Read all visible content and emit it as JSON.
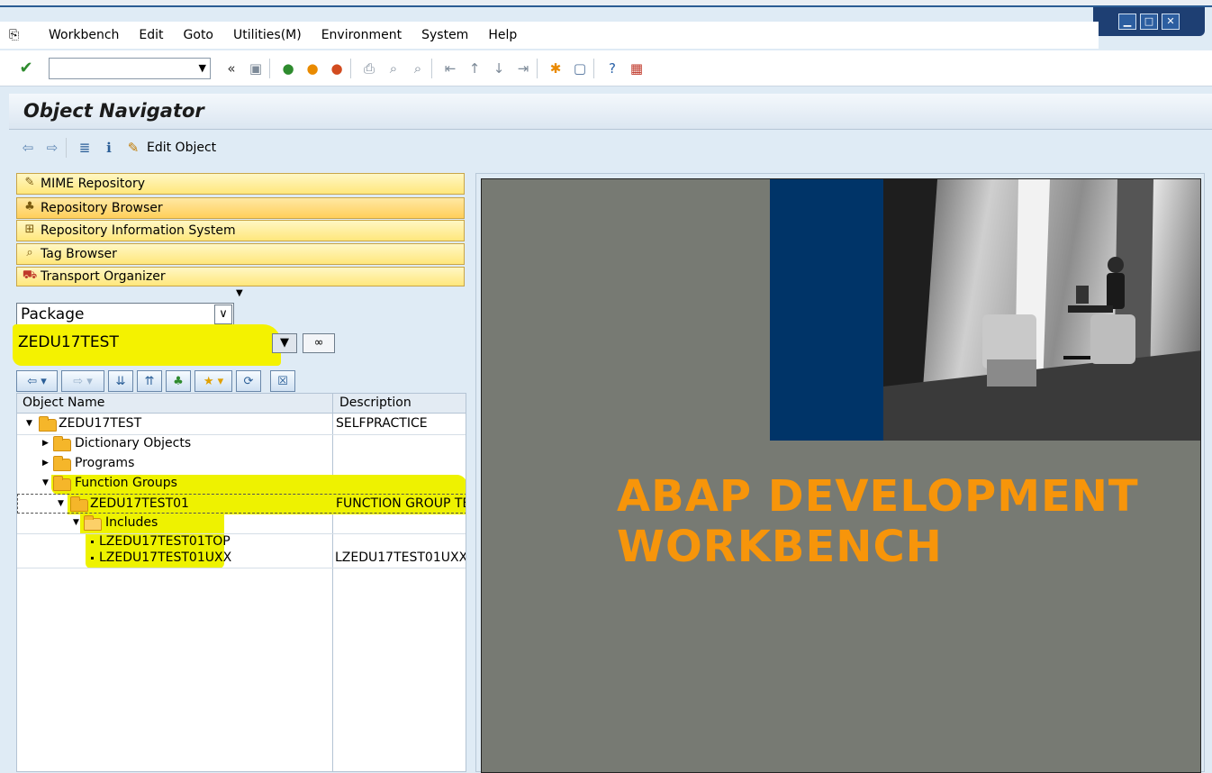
{
  "menu": {
    "items": [
      "Workbench",
      "Edit",
      "Goto",
      "Utilities(M)",
      "Environment",
      "System",
      "Help"
    ]
  },
  "command_field": {
    "value": ""
  },
  "title": "Object Navigator",
  "app_toolbar": {
    "edit_object": "Edit Object"
  },
  "nav_buttons": [
    {
      "label": "MIME Repository",
      "icon": "mime-repository-icon"
    },
    {
      "label": "Repository Browser",
      "icon": "repository-browser-icon"
    },
    {
      "label": "Repository Information System",
      "icon": "repository-info-icon"
    },
    {
      "label": "Tag Browser",
      "icon": "tag-browser-icon"
    },
    {
      "label": "Transport Organizer",
      "icon": "transport-organizer-icon"
    }
  ],
  "object_selector": {
    "type": "Package",
    "value": "ZEDU17TEST"
  },
  "tree": {
    "columns": [
      "Object Name",
      "Description"
    ],
    "rows": [
      {
        "name": "ZEDU17TEST",
        "description": "SELFPRACTICE"
      },
      {
        "name": "Dictionary Objects",
        "description": ""
      },
      {
        "name": "Programs",
        "description": ""
      },
      {
        "name": "Function Groups",
        "description": ""
      },
      {
        "name": "ZEDU17TEST01",
        "description": "FUNCTION GROUP TE"
      },
      {
        "name": "Includes",
        "description": ""
      },
      {
        "name": "LZEDU17TEST01TOP",
        "description": ""
      },
      {
        "name": "LZEDU17TEST01UXX",
        "description": "LZEDU17TEST01UXX"
      }
    ]
  },
  "splash": {
    "line1": "ABAP DEVELOPMENT",
    "line2": "WORKBENCH"
  },
  "colors": {
    "brand_orange": "#f7950a",
    "brand_blue": "#003468",
    "highlight": "#eef200"
  }
}
